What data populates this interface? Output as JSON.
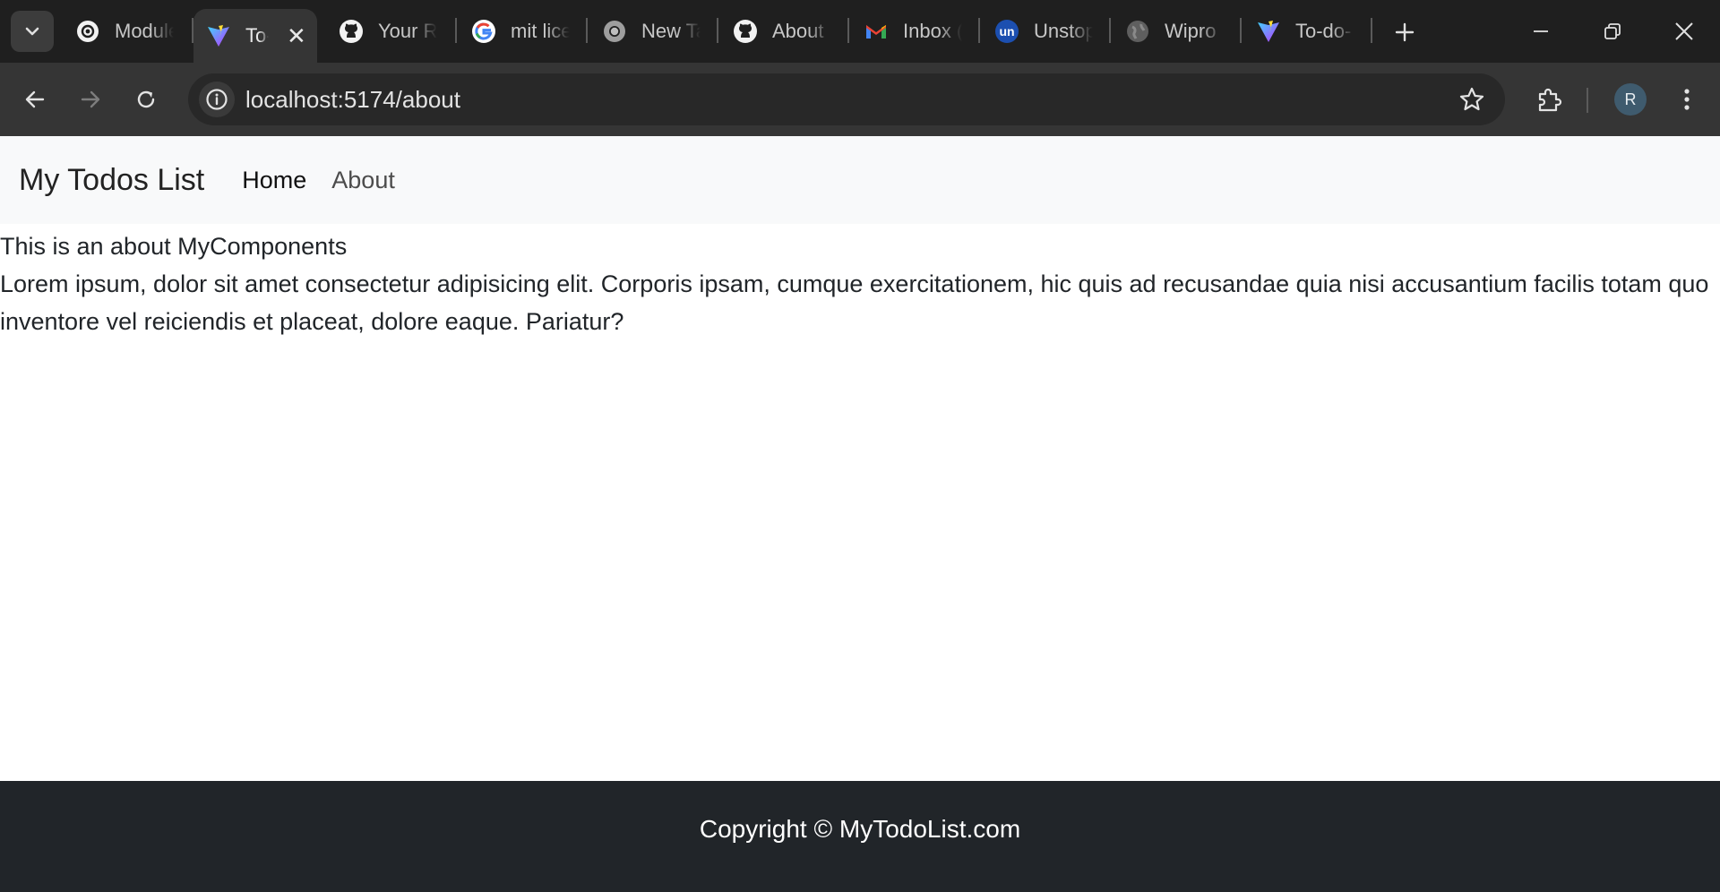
{
  "browser": {
    "tabs": [
      {
        "title": "Module",
        "icon": "openai-icon",
        "active": false
      },
      {
        "title": "To-do",
        "icon": "vite-icon",
        "active": true
      },
      {
        "title": "Your Repositories",
        "icon": "github-icon",
        "active": false
      },
      {
        "title": "mit license",
        "icon": "google-icon",
        "active": false
      },
      {
        "title": "New Tab",
        "icon": "chrome-icon",
        "active": false
      },
      {
        "title": "About",
        "icon": "github-icon",
        "active": false
      },
      {
        "title": "Inbox (",
        "icon": "gmail-icon",
        "active": false
      },
      {
        "title": "Unstop",
        "icon": "unstop-icon",
        "active": false
      },
      {
        "title": "Wipro",
        "icon": "globe-icon",
        "active": false
      },
      {
        "title": "To-do-",
        "icon": "vite-icon",
        "active": false
      }
    ],
    "address_bar": {
      "url": "localhost:5174/about"
    },
    "profile_initial": "R",
    "colors": {
      "tabstrip": "#1f1f1f",
      "toolbar": "#353535",
      "omnibox": "#282828"
    }
  },
  "app": {
    "brand": "My Todos List",
    "nav": {
      "home": "Home",
      "about": "About"
    },
    "content": {
      "heading": "This is an about MyComponents",
      "paragraph": "Lorem ipsum, dolor sit amet consectetur adipisicing elit. Corporis ipsam, cumque exercitationem, hic quis ad recusandae quia nisi accusantium facilis totam quo inventore vel reiciendis et placeat, dolore eaque. Pariatur?"
    },
    "footer": {
      "text": "Copyright © MyTodoList.com"
    },
    "colors": {
      "navbar_bg": "#f8f9fa",
      "footer_bg": "#212529",
      "text": "#212529"
    }
  }
}
